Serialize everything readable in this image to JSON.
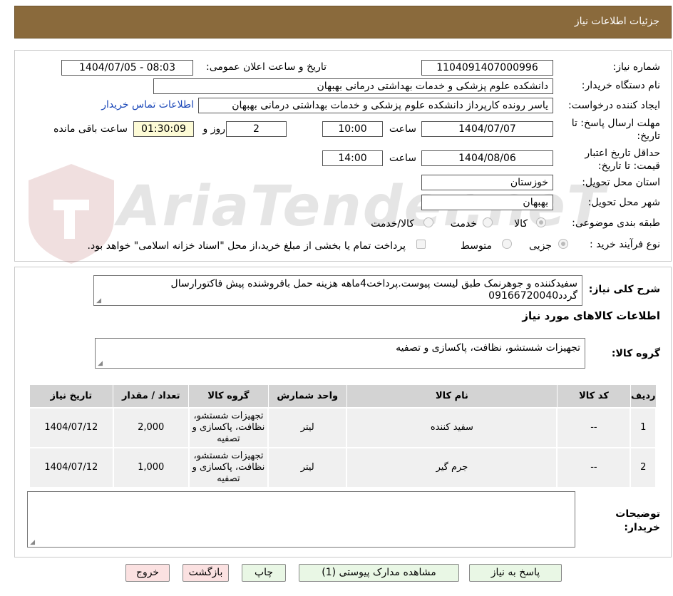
{
  "header": {
    "title": "جزئیات اطلاعات نیاز"
  },
  "labels": {
    "need_number": "شماره نیاز:",
    "announce_datetime": "تاریخ و ساعت اعلان عمومی:",
    "buyer_org": "نام دستگاه خریدار:",
    "requester": "ایجاد کننده درخواست:",
    "reply_deadline": "مهلت ارسال پاسخ: تا تاریخ:",
    "hour": "ساعت",
    "day_and": "روز و",
    "remaining": "ساعت باقی مانده",
    "price_validity": "حداقل تاریخ اعتبار قیمت: تا تاریخ:",
    "province": "استان محل تحویل:",
    "city": "شهر محل تحویل:",
    "category": "طبقه بندی موضوعی:",
    "process_type": "نوع فرآیند خرید :",
    "general_desc": "شرح کلی نیاز:",
    "goods_info": "اطلاعات کالاهای مورد نیاز",
    "goods_group": "گروه کالا:",
    "buyer_notes": "توضیحات خریدار:"
  },
  "values": {
    "need_number": "1104091407000996",
    "announce_datetime": "1404/07/05 - 08:03",
    "buyer_org": "دانشکده علوم پزشکی و خدمات بهداشتی  درمانی بهبهان",
    "requester": "یاسر رونده کارپرداز دانشکده علوم پزشکی و خدمات بهداشتی  درمانی بهبهان",
    "contact_link": "اطلاعات تماس خریدار",
    "reply_date": "1404/07/07",
    "reply_hour": "10:00",
    "days_left": "2",
    "time_left": "01:30:09",
    "validity_date": "1404/08/06",
    "validity_hour": "14:00",
    "province": "خوزستان",
    "city": "بهبهان",
    "general_desc": "سفیدکننده و جوهرنمک طبق لیست پیوست.پرداخت4ماهه هزینه حمل بافروشنده پیش فاکتورارسال گردد09166720040",
    "goods_group": "تجهیزات شستشو، نظافت، پاکسازی و تصفیه",
    "buyer_notes": ""
  },
  "category_options": [
    {
      "label": "کالا",
      "selected": true
    },
    {
      "label": "خدمت",
      "selected": false
    },
    {
      "label": "کالا/خدمت",
      "selected": false
    }
  ],
  "process_options": [
    {
      "label": "جزیی",
      "selected": true
    },
    {
      "label": "متوسط",
      "selected": false
    }
  ],
  "payment_note": "پرداخت تمام یا بخشی از مبلغ خرید،از محل \"اسناد خزانه اسلامی\" خواهد بود.",
  "watermark": {
    "text": "AriaTender.neT"
  },
  "table": {
    "headers": [
      "ردیف",
      "کد کالا",
      "نام کالا",
      "واحد شمارش",
      "گروه کالا",
      "تعداد / مقدار",
      "تاریخ نیاز"
    ],
    "rows": [
      [
        "1",
        "--",
        "سفید کننده",
        "لیتر",
        "تجهیزات شستشو، نظافت، پاکسازی و تصفیه",
        "2,000",
        "1404/07/12"
      ],
      [
        "2",
        "--",
        "جرم گیر",
        "لیتر",
        "تجهیزات شستشو، نظافت، پاکسازی و تصفیه",
        "1,000",
        "1404/07/12"
      ]
    ]
  },
  "buttons": {
    "reply": "پاسخ به نیاز",
    "attachments": "مشاهده مدارک پیوستی (1)",
    "print": "چاپ",
    "back": "بازگشت",
    "exit": "خروج"
  },
  "colors": {
    "header_bg": "#8a6a3c",
    "button_green": "#e9f7e5",
    "button_pink": "#fbe1e1",
    "highlight_yellow": "#fdfbd6"
  }
}
